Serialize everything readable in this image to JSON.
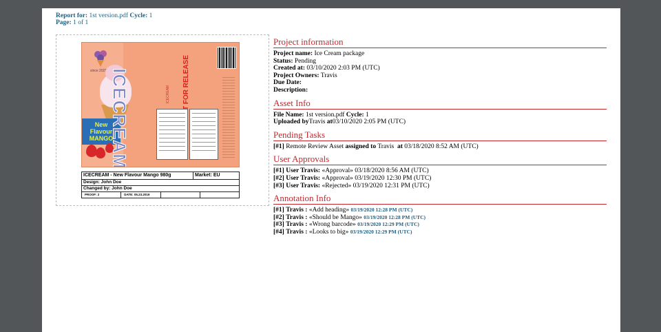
{
  "report": {
    "report_for_label": "Report for:",
    "file": "1st version.pdf",
    "cycle_label": "Cycle:",
    "cycle": "1",
    "page_label": "Page:",
    "page": "1 of 1"
  },
  "artwork": {
    "title_vertical": "ICECREAM",
    "not_for_release": "NOT FOR RELEASE",
    "brand_small": "ICECREAM",
    "since": "since 2021",
    "flavour_line1": "New",
    "flavour_line2": "Flavour",
    "flavour_line3": "MANGO",
    "nutrition_label": "nutrition-facts-panel"
  },
  "info_table": {
    "product": "ICECREAM - New Flavour Mango 980g",
    "market": "Market: EU",
    "design": "Design: John Doe",
    "changed_by": "Changed by: John Doe",
    "proof": "PROOF: 2",
    "date": "DATE: 05.23.2019"
  },
  "sections": {
    "project_information": "Project information",
    "asset_info": "Asset Info",
    "pending_tasks": "Pending Tasks",
    "user_approvals": "User Approvals",
    "annotation_info": "Annotation Info"
  },
  "project": {
    "name_label": "Project name:",
    "name": "Ice Cream package",
    "status_label": "Status:",
    "status": "Pending",
    "created_label": "Created at:",
    "created": "03/10/2020 2:03 PM (UTC)",
    "owners_label": "Project Owners:",
    "owners": "Travis",
    "due_label": "Due Date:",
    "description_label": "Description:"
  },
  "asset": {
    "file_label": "File Name:",
    "file": "1st version.pdf",
    "cycle_label": "Cycle:",
    "cycle": "1",
    "uploaded_label": "Uploaded by",
    "uploaded_by": "Travis",
    "at_label": "at",
    "uploaded_at": "03/10/2020 2:05 PM (UTC)"
  },
  "pending_tasks": [
    {
      "idx": "[#1]",
      "task": "Remote Review Asset",
      "assigned_label": "assigned to",
      "assignee": "Travis",
      "at_label": "at",
      "time": "03/18/2020 8:52 AM (UTC)"
    }
  ],
  "approvals": [
    {
      "idx": "[#1]",
      "user": "User Travis:",
      "status": "«Approval»",
      "time": "03/18/2020 8:56 AM (UTC)"
    },
    {
      "idx": "[#2]",
      "user": "User Travis:",
      "status": "«Approval»",
      "time": "03/19/2020 12:30 PM (UTC)"
    },
    {
      "idx": "[#3]",
      "user": "User Travis:",
      "status": "«Rejected»",
      "time": "03/19/2020 12:31 PM (UTC)"
    }
  ],
  "annotations": [
    {
      "idx": "[#1]",
      "user": "Travis :",
      "text": "«Add heading»",
      "time": "03/19/2020 12:28 PM (UTC)"
    },
    {
      "idx": "[#2]",
      "user": "Travis :",
      "text": "«Should be Mango»",
      "time": "03/19/2020 12:28 PM (UTC)"
    },
    {
      "idx": "[#3]",
      "user": "Travis :",
      "text": "«Wrong barcode»",
      "time": "03/19/2020 12:29 PM (UTC)"
    },
    {
      "idx": "[#4]",
      "user": "Travis :",
      "text": "«Looks to big»",
      "time": "03/19/2020 12:29 PM (UTC)"
    }
  ],
  "colors": {
    "section_title": "#c1272d",
    "report_head": "#1f5e7e",
    "viewer_bg": "#525659"
  }
}
